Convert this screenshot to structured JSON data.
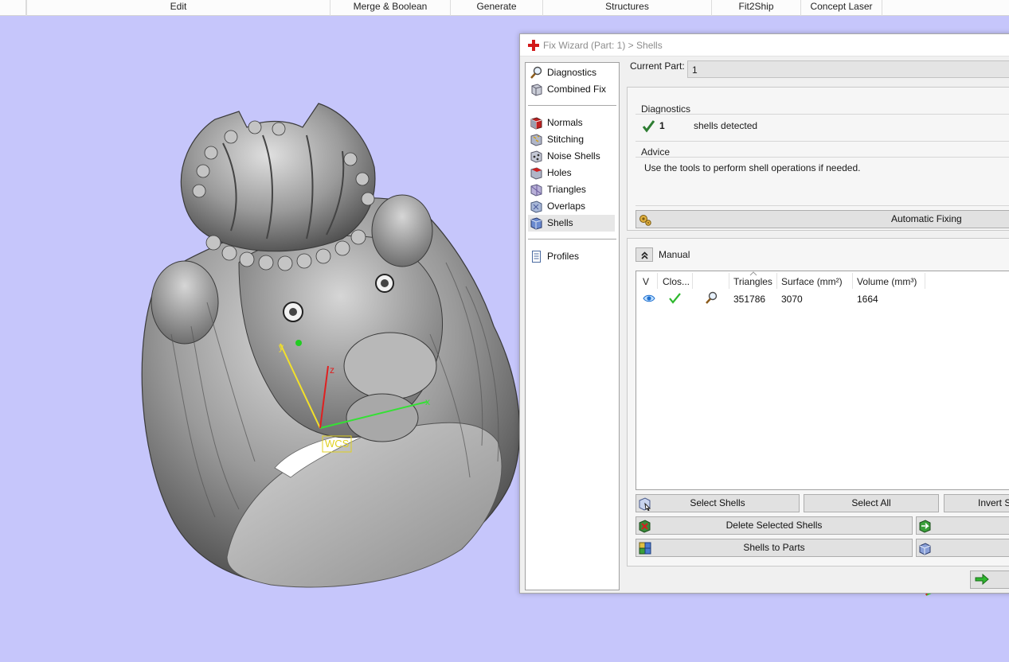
{
  "menu": {
    "items": [
      "Edit",
      "Merge & Boolean",
      "Generate",
      "Structures",
      "Fit2Ship",
      "Concept Laser"
    ]
  },
  "viewport": {
    "wcs_label": "WCS",
    "axis_labels": {
      "x": "x",
      "y": "y",
      "z": "z"
    },
    "background_color": "#c6c6fb"
  },
  "wizard": {
    "title": "Fix Wizard (Part: 1) > Shells",
    "nav": {
      "items": [
        {
          "label": "Diagnostics",
          "icon": "magnifier-icon"
        },
        {
          "label": "Combined Fix",
          "icon": "combined-fix-icon"
        },
        {
          "label": "Normals",
          "icon": "normals-icon"
        },
        {
          "label": "Stitching",
          "icon": "stitching-icon"
        },
        {
          "label": "Noise Shells",
          "icon": "noise-shells-icon"
        },
        {
          "label": "Holes",
          "icon": "holes-icon"
        },
        {
          "label": "Triangles",
          "icon": "triangles-icon"
        },
        {
          "label": "Overlaps",
          "icon": "overlaps-icon"
        },
        {
          "label": "Shells",
          "icon": "shells-icon",
          "selected": true
        },
        {
          "label": "Profiles",
          "icon": "profiles-icon"
        }
      ]
    },
    "current_part": {
      "label": "Current Part:",
      "value": "1"
    },
    "diagnostics": {
      "title": "Diagnostics",
      "count": "1",
      "text": "shells detected"
    },
    "advice": {
      "title": "Advice",
      "text": "Use the tools to perform shell operations if needed."
    },
    "automatic_fixing_label": "Automatic Fixing",
    "manual": {
      "title": "Manual",
      "table": {
        "columns": [
          "V",
          "Clos...",
          "",
          "Triangles",
          "Surface (mm²)",
          "Volume (mm³)"
        ],
        "rows": [
          {
            "visible": true,
            "closed": true,
            "triangles": "351786",
            "surface": "3070",
            "volume": "1664"
          }
        ]
      },
      "buttons": {
        "select_shells": "Select Shells",
        "select_all": "Select All",
        "invert": "Invert S",
        "delete_selected": "Delete Selected Shells",
        "shells_to_parts": "Shells to Parts"
      }
    },
    "colors": {
      "check_green": "#2e7d32",
      "accent_green": "#2eb82e",
      "eye_blue": "#1e6fcf"
    }
  }
}
